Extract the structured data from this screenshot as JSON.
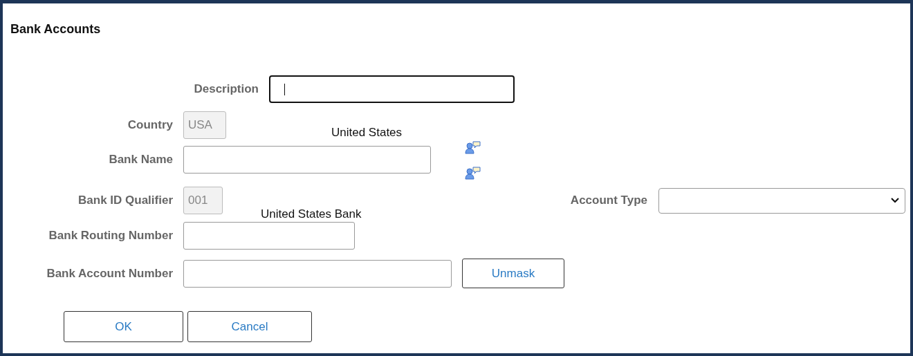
{
  "title": "Bank Accounts",
  "description": {
    "label": "Description",
    "focused": true
  },
  "country": {
    "label": "Country",
    "value": "USA",
    "disabled": true
  },
  "country_name": "United States",
  "bank_name": {
    "label": "Bank Name"
  },
  "bank_id_qualifier": {
    "label": "Bank ID Qualifier",
    "value": "001",
    "disabled": true
  },
  "qualifier_name": "United States Bank",
  "account_type": {
    "label": "Account Type"
  },
  "bank_routing_number": {
    "label": "Bank Routing Number"
  },
  "bank_account_number": {
    "label": "Bank Account Number"
  },
  "unmask_button": "Unmask",
  "buttons": [
    "OK",
    "Cancel"
  ]
}
